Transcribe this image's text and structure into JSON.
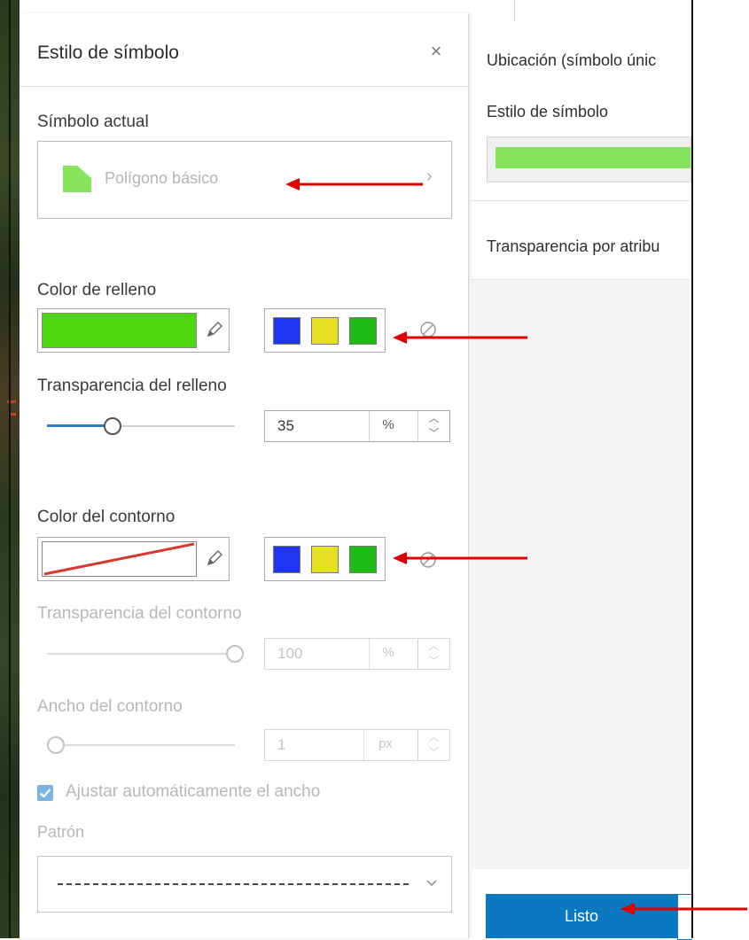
{
  "panel": {
    "title": "Estilo de símbolo",
    "close_glyph": "×",
    "current_symbol": {
      "label": "Símbolo actual",
      "name": "Polígono básico",
      "color": "#86e35c"
    },
    "fill": {
      "label": "Color de relleno",
      "color": "#4cd70e",
      "quick_swatches": [
        "#1f36f0",
        "#e6e023",
        "#1fbc18"
      ],
      "transparency_label": "Transparencia del relleno",
      "transparency_value": "35",
      "transparency_unit": "%"
    },
    "outline": {
      "label": "Color del contorno",
      "color": "#d8382e",
      "quick_swatches": [
        "#1f36f0",
        "#e6e023",
        "#1fbc18"
      ],
      "transparency_label": "Transparencia del contorno",
      "transparency_value": "100",
      "transparency_unit": "%",
      "width_label": "Ancho del contorno",
      "width_value": "1",
      "width_unit": "px",
      "auto_width_label": "Ajustar automáticamente el ancho",
      "auto_width_checked": true,
      "pattern_label": "Patrón"
    }
  },
  "right_panel": {
    "layer_title": "Ubicación (símbolo únic",
    "symbol_style_label": "Estilo de símbolo",
    "symbol_color": "#86e35c",
    "transparency_by_attr": "Transparencia por atribu",
    "done_button": "Listo"
  },
  "icons": {
    "close": "close-icon",
    "pencil": "pencil-icon",
    "none": "no-color-icon",
    "chevron_right": "chevron-right-icon",
    "chevron_down": "chevron-down-icon",
    "check": "check-icon",
    "arrow": "red-arrow-annotation"
  },
  "annotation_color": "#e00000"
}
